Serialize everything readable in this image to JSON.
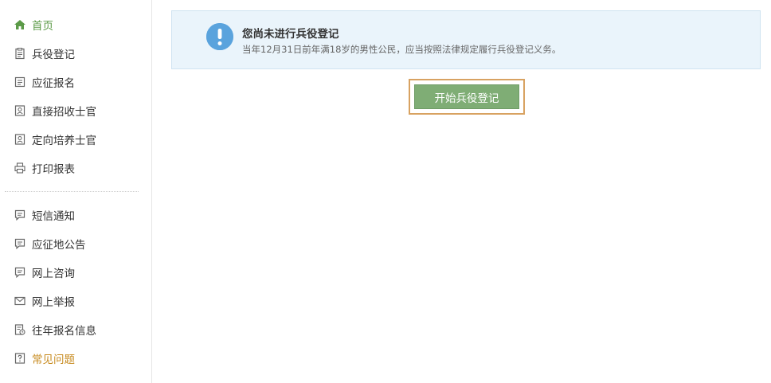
{
  "sidebar": {
    "group1": [
      {
        "label": "首页",
        "icon": "home-icon",
        "state": "active"
      },
      {
        "label": "兵役登记",
        "icon": "clipboard-icon",
        "state": "normal"
      },
      {
        "label": "应征报名",
        "icon": "document-icon",
        "state": "normal"
      },
      {
        "label": "直接招收士官",
        "icon": "id-card-icon",
        "state": "normal"
      },
      {
        "label": "定向培养士官",
        "icon": "id-card-icon",
        "state": "normal"
      },
      {
        "label": "打印报表",
        "icon": "printer-icon",
        "state": "normal"
      }
    ],
    "group2": [
      {
        "label": "短信通知",
        "icon": "chat-icon",
        "state": "normal"
      },
      {
        "label": "应征地公告",
        "icon": "chat-icon",
        "state": "normal"
      },
      {
        "label": "网上咨询",
        "icon": "chat-icon",
        "state": "normal"
      },
      {
        "label": "网上举报",
        "icon": "mail-icon",
        "state": "normal"
      },
      {
        "label": "往年报名信息",
        "icon": "history-icon",
        "state": "normal"
      },
      {
        "label": "常见问题",
        "icon": "question-icon",
        "state": "highlight"
      }
    ]
  },
  "notice": {
    "title": "您尚未进行兵役登记",
    "description": "当年12月31日前年满18岁的男性公民，应当按照法律规定履行兵役登记义务。"
  },
  "actions": {
    "start_label": "开始兵役登记"
  },
  "colors": {
    "active": "#5b9a47",
    "highlight": "#c78a1e",
    "button": "#7fad75",
    "button_frame": "#d8a261",
    "notice_bg": "#eaf4fb",
    "info_icon": "#5aa3dd"
  }
}
